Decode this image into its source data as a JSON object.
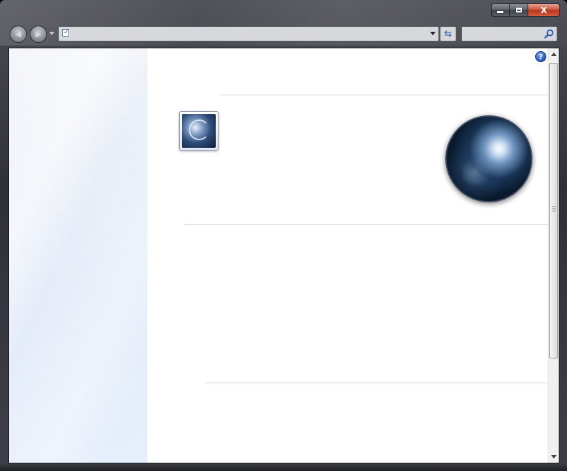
{
  "window": {
    "caption_buttons": {
      "minimize_icon": "minimize-icon",
      "maximize_icon": "maximize-icon",
      "close_label": "X"
    }
  },
  "navbar": {
    "back_icon": "back-arrow-icon",
    "forward_icon": "forward-arrow-icon",
    "address": {
      "value": "",
      "favicon": "page-check-icon"
    },
    "refresh_icon": "refresh-icon",
    "search": {
      "value": "",
      "icon": "search-icon"
    }
  },
  "content": {
    "help_label": "?",
    "help_icon": "help-icon",
    "app_tile_icon": "swirl-app-icon",
    "orb_image": "fractal-orb-image"
  },
  "colors": {
    "frame": "#2f3137",
    "close_button": "#c6523b",
    "sidebar": "#e6eef9",
    "divider": "#cfd1d4"
  }
}
